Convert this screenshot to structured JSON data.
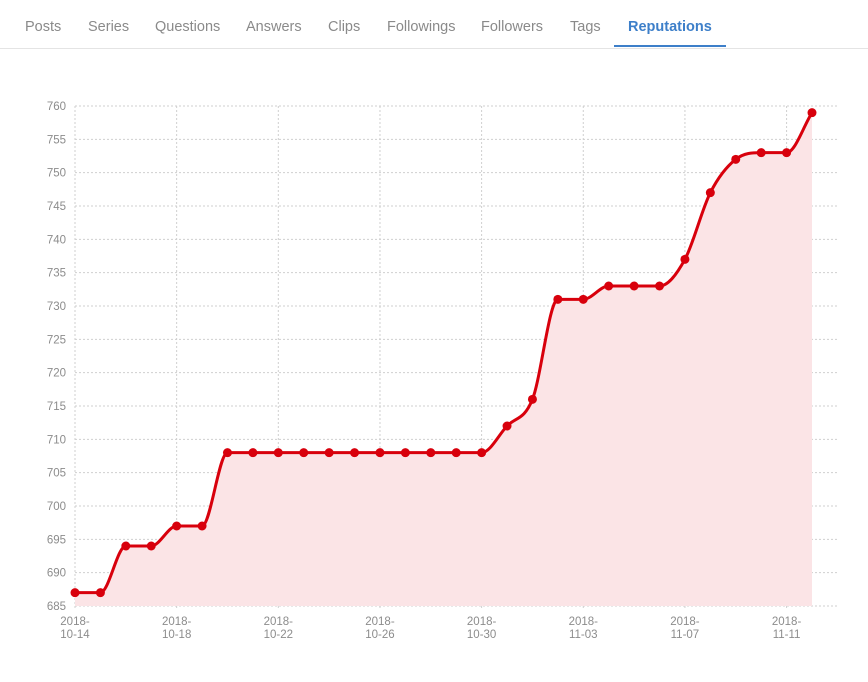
{
  "tabs": [
    {
      "label": "Posts",
      "active": false
    },
    {
      "label": "Series",
      "active": false
    },
    {
      "label": "Questions",
      "active": false
    },
    {
      "label": "Answers",
      "active": false
    },
    {
      "label": "Clips",
      "active": false
    },
    {
      "label": "Followings",
      "active": false
    },
    {
      "label": "Followers",
      "active": false
    },
    {
      "label": "Tags",
      "active": false
    },
    {
      "label": "Reputations",
      "active": true
    }
  ],
  "colors": {
    "accent": "#3d7fc9",
    "line": "#d8000c",
    "fill": "#fbe4e6"
  },
  "chart_data": {
    "type": "area",
    "title": "",
    "xlabel": "",
    "ylabel": "",
    "ylim": [
      685,
      760
    ],
    "yticks": [
      685,
      690,
      695,
      700,
      705,
      710,
      715,
      720,
      725,
      730,
      735,
      740,
      745,
      750,
      755,
      760
    ],
    "xticks": [
      "2018-10-14",
      "2018-10-18",
      "2018-10-22",
      "2018-10-26",
      "2018-10-30",
      "2018-11-03",
      "2018-11-07",
      "2018-11-11"
    ],
    "grid": true,
    "series": [
      {
        "x": [
          "2018-10-14",
          "2018-10-15",
          "2018-10-16",
          "2018-10-17",
          "2018-10-18",
          "2018-10-19",
          "2018-10-20",
          "2018-10-21",
          "2018-10-22",
          "2018-10-23",
          "2018-10-24",
          "2018-10-25",
          "2018-10-26",
          "2018-10-27",
          "2018-10-28",
          "2018-10-29",
          "2018-10-30",
          "2018-10-31",
          "2018-11-01",
          "2018-11-02",
          "2018-11-03",
          "2018-11-04",
          "2018-11-05",
          "2018-11-06",
          "2018-11-07",
          "2018-11-08",
          "2018-11-09",
          "2018-11-10",
          "2018-11-11",
          "2018-11-12"
        ],
        "values": [
          687,
          687,
          694,
          694,
          697,
          697,
          708,
          708,
          708,
          708,
          708,
          708,
          708,
          708,
          708,
          708,
          708,
          712,
          716,
          731,
          731,
          733,
          733,
          733,
          737,
          747,
          752,
          753,
          753,
          759
        ]
      }
    ]
  }
}
